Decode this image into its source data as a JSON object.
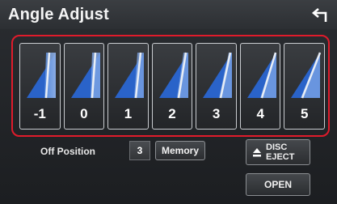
{
  "header": {
    "title": "Angle Adjust",
    "back_icon": "back-arrow-icon"
  },
  "angles": {
    "selected_outline_color": "#e01b2b",
    "items": [
      {
        "label": "-1"
      },
      {
        "label": "0"
      },
      {
        "label": "1"
      },
      {
        "label": "2"
      },
      {
        "label": "3"
      },
      {
        "label": "4"
      },
      {
        "label": "5"
      }
    ]
  },
  "off_position": {
    "label": "Off Position",
    "value": "3"
  },
  "memory_button": {
    "label": "Memory"
  },
  "disc_eject_button": {
    "line1": "DISC",
    "line2": "EJECT",
    "icon": "eject-icon"
  },
  "open_button": {
    "label": "OPEN"
  }
}
